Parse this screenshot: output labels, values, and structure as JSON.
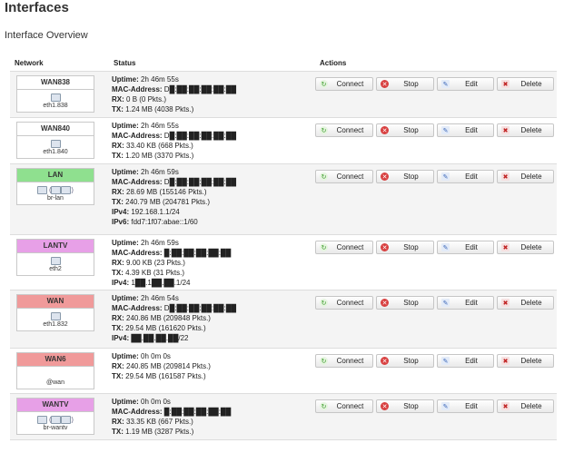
{
  "page": {
    "title": "Interfaces",
    "section": "Interface Overview"
  },
  "columns": {
    "network": "Network",
    "status": "Status",
    "actions": "Actions"
  },
  "labels": {
    "uptime": "Uptime:",
    "mac": "MAC-Address:",
    "rx": "RX:",
    "tx": "TX:",
    "ipv4": "IPv4:",
    "ipv6": "IPv6:"
  },
  "buttons": {
    "connect": "Connect",
    "stop": "Stop",
    "edit": "Edit",
    "delete": "Delete"
  },
  "interfaces": [
    {
      "name": "WAN838",
      "color": "#ffffff",
      "device": "eth1.838",
      "icon": "ethernet-port-icon",
      "uptime": "2h 46m 55s",
      "mac": "D█:██:██:██:██:██",
      "rx": "0 B (0 Pkts.)",
      "tx": "1.24 MB (4038 Pkts.)",
      "ipv4": "",
      "ipv6": ""
    },
    {
      "name": "WAN840",
      "color": "#ffffff",
      "device": "eth1.840",
      "icon": "ethernet-port-icon",
      "uptime": "2h 46m 55s",
      "mac": "D█:██:██:██:██:██",
      "rx": "33.40 KB (668 Pkts.)",
      "tx": "1.20 MB (3370 Pkts.)",
      "ipv4": "",
      "ipv6": ""
    },
    {
      "name": "LAN",
      "color": "#8fe08f",
      "device": "br-lan",
      "icon": "bridge-icon",
      "uptime": "2h 46m 59s",
      "mac": "D█:██:██:██:██:██",
      "rx": "28.69 MB (155146 Pkts.)",
      "tx": "240.79 MB (204781 Pkts.)",
      "ipv4": "192.168.1.1/24",
      "ipv6": "fdd7:1f07:abae::1/60"
    },
    {
      "name": "LANTV",
      "color": "#e7a0e7",
      "device": "eth2",
      "icon": "ethernet-port-icon",
      "uptime": "2h 46m 59s",
      "mac": "█:██:██:██:██:██",
      "rx": "9.00 KB (23 Pkts.)",
      "tx": "4.39 KB (31 Pkts.)",
      "ipv4": "1██.1██.██.1/24",
      "ipv6": ""
    },
    {
      "name": "WAN",
      "color": "#f09a9a",
      "device": "eth1.832",
      "icon": "ethernet-port-icon",
      "uptime": "2h 46m 54s",
      "mac": "D█:██:██:██:██:██",
      "rx": "240.86 MB (209848 Pkts.)",
      "tx": "29.54 MB (161620 Pkts.)",
      "ipv4": "██.██.██.██/22",
      "ipv6": ""
    },
    {
      "name": "WAN6",
      "color": "#f09a9a",
      "device": "@wan",
      "icon": "alias-icon",
      "uptime": "0h 0m 0s",
      "mac": "",
      "rx": "240.85 MB (209814 Pkts.)",
      "tx": "29.54 MB (161587 Pkts.)",
      "ipv4": "",
      "ipv6": ""
    },
    {
      "name": "WANTV",
      "color": "#e7a0e7",
      "device": "br-wantv",
      "icon": "bridge-icon",
      "uptime": "0h 0m 0s",
      "mac": "█:██:██:██:██:██",
      "rx": "33.35 KB (667 Pkts.)",
      "tx": "1.19 MB (3287 Pkts.)",
      "ipv4": "",
      "ipv6": ""
    }
  ]
}
